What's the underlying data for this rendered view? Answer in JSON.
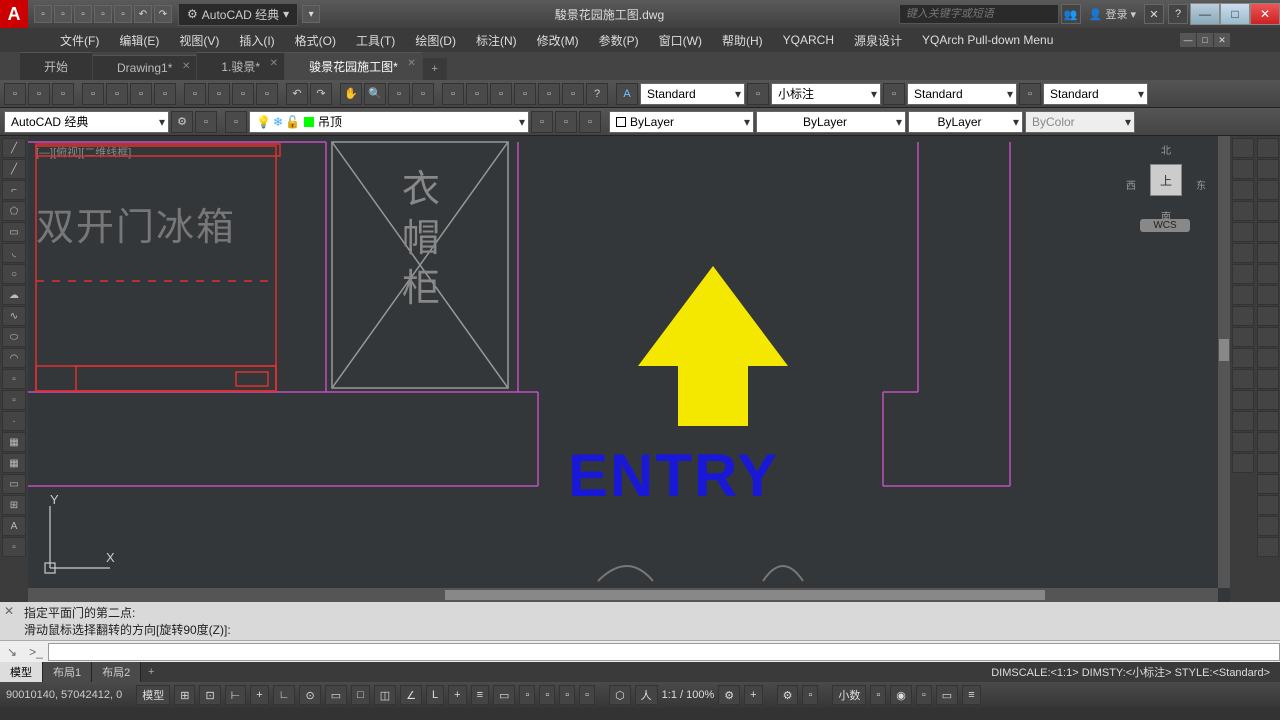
{
  "title": "駿景花园施工图.dwg",
  "workspace": "AutoCAD 经典",
  "search_placeholder": "键入关键字或短语",
  "login": "登录",
  "menus": [
    "文件(F)",
    "编辑(E)",
    "视图(V)",
    "插入(I)",
    "格式(O)",
    "工具(T)",
    "绘图(D)",
    "标注(N)",
    "修改(M)",
    "参数(P)",
    "窗口(W)",
    "帮助(H)",
    "YQARCH",
    "源泉设计",
    "YQArch Pull-down Menu"
  ],
  "doc_tabs": [
    {
      "label": "开始",
      "close": false
    },
    {
      "label": "Drawing1*",
      "close": true
    },
    {
      "label": "1.骏景*",
      "close": true
    },
    {
      "label": "骏景花园施工图*",
      "close": true,
      "active": true
    }
  ],
  "style_dd1": "Standard",
  "style_dd2": "小标注",
  "style_dd3": "Standard",
  "style_dd4": "Standard",
  "workspace_dd": "AutoCAD 经典",
  "layer_dd": "吊顶",
  "prop_color": "ByLayer",
  "prop_lw": "ByLayer",
  "prop_lt": "ByLayer",
  "prop_bycolor": "ByColor",
  "drawing_text": {
    "entry": "ENTRY",
    "fridge": "双开门冰箱",
    "closet": [
      "衣",
      "帽",
      "柜"
    ],
    "topview": "[—][俯视][二维线框]"
  },
  "viewcube": {
    "n": "北",
    "s": "南",
    "e": "东",
    "w": "西",
    "face": "上",
    "wcs": "WCS"
  },
  "cmd_lines": [
    "指定平面门的第二点:",
    "滑动鼠标选择翻转的方向[旋转90度(Z)]:"
  ],
  "cmd_prompt": ">_",
  "layout_tabs": [
    "模型",
    "布局1",
    "布局2"
  ],
  "status_info": "DIMSCALE:<1:1> DIMSTY:<小标注> STYLE:<Standard>",
  "coords": "90010140, 57042412, 0",
  "sb_model": "模型",
  "sb_scale": "1:1 / 100%",
  "sb_dec": "小数"
}
